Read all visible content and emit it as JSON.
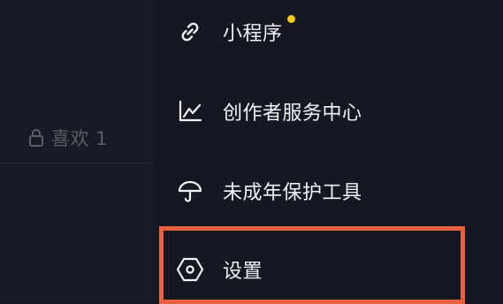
{
  "left_panel": {
    "likes_tab": {
      "icon": "lock-icon",
      "label": "喜欢 1"
    }
  },
  "menu": {
    "items": [
      {
        "id": "mini-program",
        "icon": "link-icon",
        "label": "小程序",
        "has_badge_dot": true
      },
      {
        "id": "creator-center",
        "icon": "chart-icon",
        "label": "创作者服务中心"
      },
      {
        "id": "minor-protection",
        "icon": "umbrella-icon",
        "label": "未成年保护工具"
      },
      {
        "id": "settings",
        "icon": "hexagon-settings-icon",
        "label": "设置",
        "highlighted": true
      }
    ]
  },
  "colors": {
    "background": "#161721",
    "left_panel": "#191a23",
    "text": "#f3f3f5",
    "muted_text": "#5b5c64",
    "badge_dot": "#f5c518",
    "highlight": "#e8603d"
  }
}
